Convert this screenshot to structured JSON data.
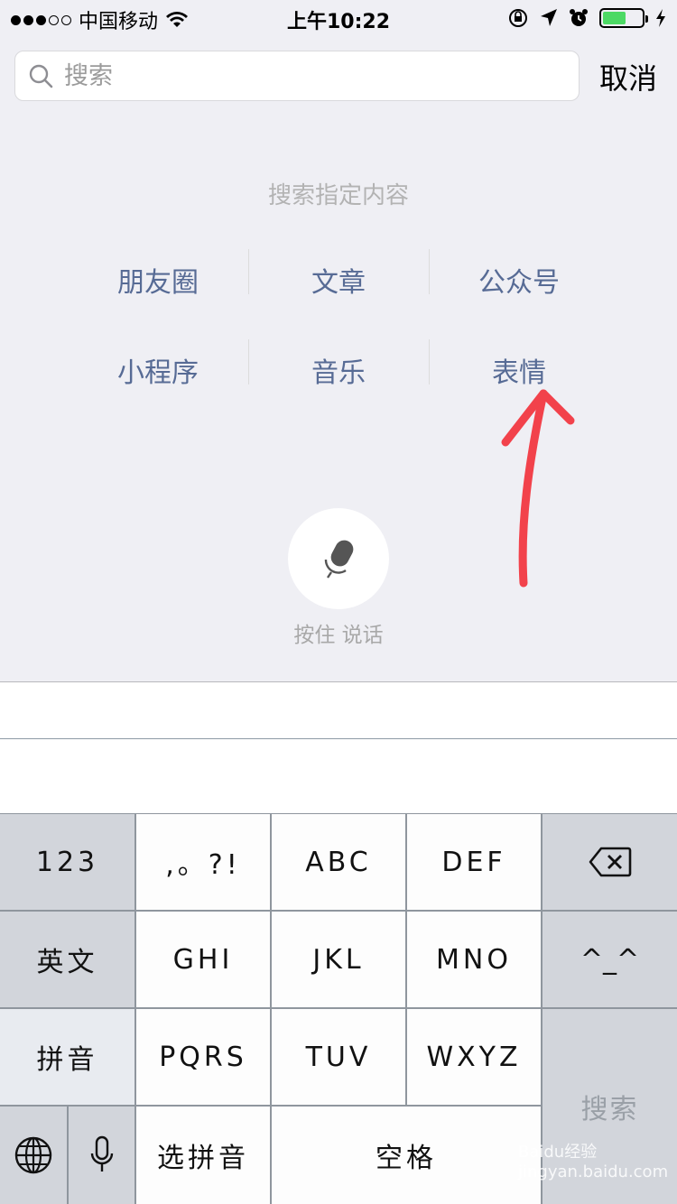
{
  "status_bar": {
    "carrier": "中国移动",
    "time": "上午10:22"
  },
  "search": {
    "placeholder": "搜索",
    "cancel_label": "取消"
  },
  "hint": "搜索指定内容",
  "categories": [
    [
      "朋友圈",
      "文章",
      "公众号"
    ],
    [
      "小程序",
      "音乐",
      "表情"
    ]
  ],
  "voice": {
    "label": "按住 说话"
  },
  "keyboard": {
    "row1": [
      "123",
      ",。?!",
      "ABC",
      "DEF"
    ],
    "row2": [
      "英文",
      "GHI",
      "JKL",
      "MNO",
      "^_^"
    ],
    "row3": [
      "拼音",
      "PQRS",
      "TUV",
      "WXYZ"
    ],
    "row4": [
      "选拼音",
      "空格"
    ],
    "search_key": "搜索"
  },
  "watermark": "Baidu经验 jingyan.baidu.com",
  "colors": {
    "link": "#576b95",
    "battery": "#4cd964",
    "annotation_arrow": "#f2424b"
  }
}
